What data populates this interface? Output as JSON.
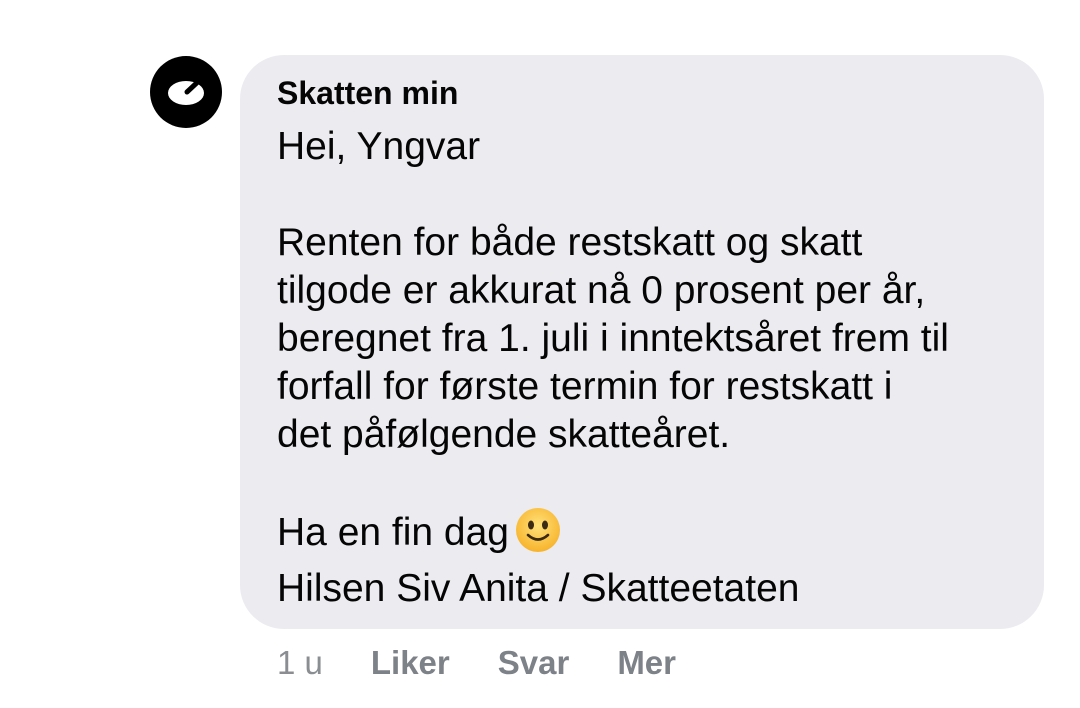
{
  "comment": {
    "author": "Skatten min",
    "avatar_icon": "skatteetaten-logo-icon",
    "greeting": "Hei, Yngvar",
    "paragraph_lines": [
      "Renten for både restskatt og skatt",
      "tilgode er akkurat nå 0 prosent per år,",
      "beregnet fra 1. juli i inntektsåret frem til",
      "forfall for første termin for restskatt i",
      "det påfølgende skatteåret."
    ],
    "closing": "Ha en fin dag",
    "closing_emoji": "slightly-smiling-face-icon",
    "signature": "Hilsen Siv Anita / Skatteetaten"
  },
  "actions": {
    "time": "1 u",
    "like": "Liker",
    "reply": "Svar",
    "more": "Mer"
  },
  "colors": {
    "bubble": "#ebebf0",
    "text": "#050505",
    "muted": "#7d8188"
  }
}
